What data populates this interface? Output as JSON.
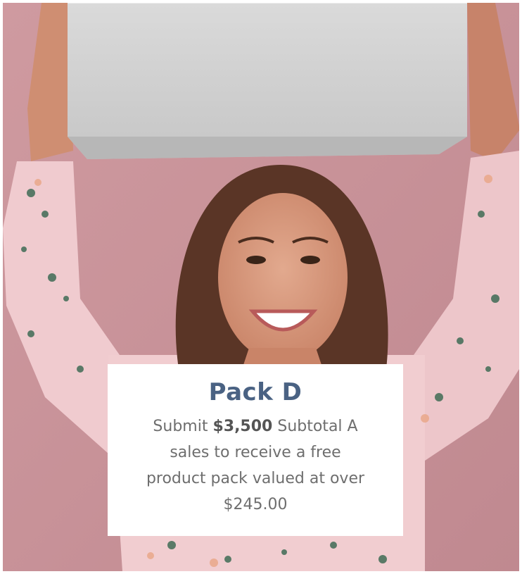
{
  "promo": {
    "title": "Pack D",
    "line1_pre": "Submit ",
    "amount": "$3,500",
    "line1_post": " Subtotal A",
    "line2": "sales to receive a free",
    "line3": "product pack valued at over",
    "line4": "$245.00"
  },
  "colors": {
    "background": "#c9939a",
    "title": "#4a6283",
    "body_text": "#6e6e6e",
    "card": "#ffffff"
  }
}
